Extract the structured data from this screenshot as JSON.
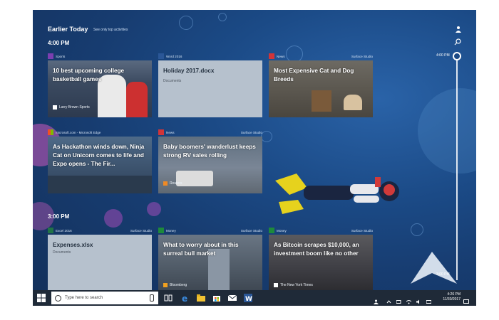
{
  "header": {
    "title": "Earlier Today",
    "see_only_top": "See only top activities"
  },
  "times": {
    "group1": "4:00 PM",
    "group2": "3:00 PM"
  },
  "timeline": {
    "top_label": "4:00 PM",
    "bottom_label": "3:00 PM"
  },
  "cards": [
    {
      "app": "Sports",
      "device": "",
      "title": "10 best upcoming college basketball games",
      "source": "Larry Brown Sports",
      "kind": "photo",
      "app_color": "#7b3fb0"
    },
    {
      "app": "Word 2016",
      "device": "",
      "title": "Holiday 2017.docx",
      "source": "Documents",
      "kind": "doc",
      "app_color": "#2b5797"
    },
    {
      "app": "News",
      "device": "Surface Studio",
      "title": "Most Expensive Cat and Dog Breeds",
      "source": "",
      "kind": "photo",
      "app_color": "#d13438"
    },
    {
      "app": "microsoft.com - Microsoft Edge",
      "device": "",
      "title": "As Hackathon winds down, Ninja Cat on Unicorn comes to life and Expo opens - The Fir...",
      "source": "",
      "kind": "photo",
      "app_color": "#f25022"
    },
    {
      "app": "News",
      "device": "Surface Studio",
      "title": "Baby boomers' wanderlust keeps strong RV sales rolling",
      "source": "Reuters",
      "kind": "photo",
      "app_color": "#d13438"
    },
    {
      "app": "Excel 2016",
      "device": "Surface Studio",
      "title": "Expenses.xlsx",
      "source": "Documents",
      "kind": "doc",
      "app_color": "#217346"
    },
    {
      "app": "Money",
      "device": "Surface Studio",
      "title": "What to worry about in this surreal bull market",
      "source": "Bloomberg",
      "kind": "photo",
      "app_color": "#1e8a3b"
    },
    {
      "app": "Money",
      "device": "Surface Studio",
      "title": "As Bitcoin scrapes $10,000, an investment boom like no other",
      "source": "The New York Times",
      "kind": "photo",
      "app_color": "#1e8a3b"
    }
  ],
  "taskbar": {
    "search_placeholder": "Type here to search",
    "time": "4:26 PM",
    "date": "11/30/2017",
    "icons": [
      "windows-start-icon",
      "task-view-icon",
      "edge-icon",
      "file-explorer-icon",
      "store-icon",
      "mail-icon",
      "word-icon"
    ]
  }
}
